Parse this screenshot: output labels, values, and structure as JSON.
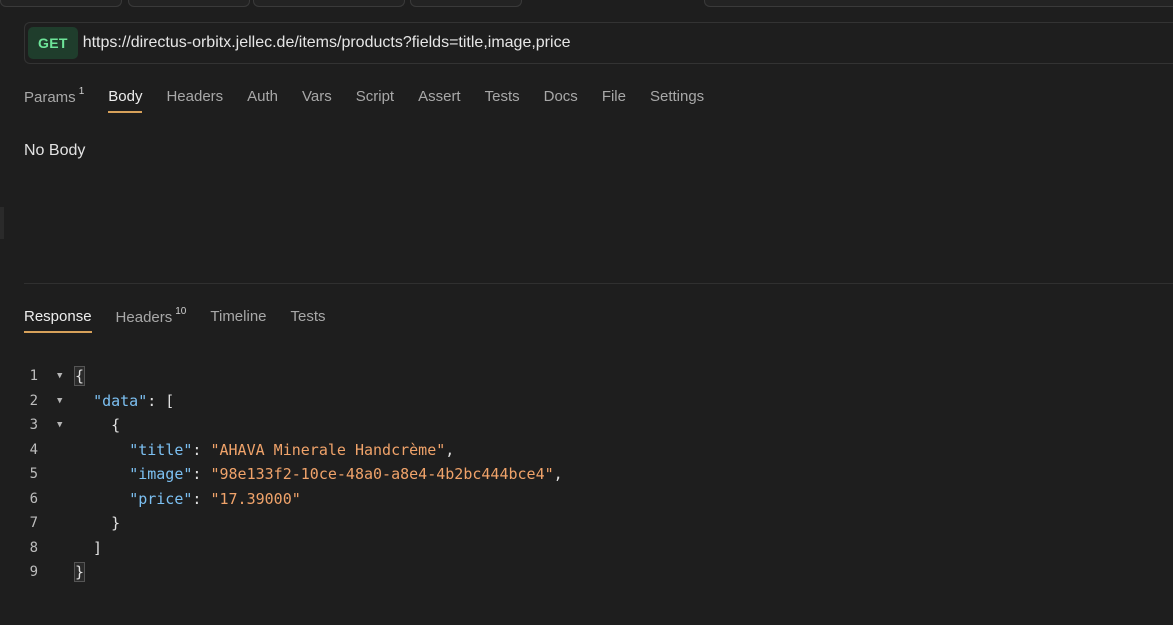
{
  "request": {
    "method": "GET",
    "url": "https://directus-orbitx.jellec.de/items/products?fields=title,image,price"
  },
  "request_tabs": [
    {
      "label": "Params",
      "count": "1"
    },
    {
      "label": "Body",
      "active": true
    },
    {
      "label": "Headers"
    },
    {
      "label": "Auth"
    },
    {
      "label": "Vars"
    },
    {
      "label": "Script"
    },
    {
      "label": "Assert"
    },
    {
      "label": "Tests"
    },
    {
      "label": "Docs"
    },
    {
      "label": "File"
    },
    {
      "label": "Settings"
    }
  ],
  "body_panel": {
    "message": "No Body"
  },
  "response_tabs": [
    {
      "label": "Response",
      "active": true
    },
    {
      "label": "Headers",
      "count": "10"
    },
    {
      "label": "Timeline"
    },
    {
      "label": "Tests"
    }
  ],
  "response_code": [
    {
      "num": "1",
      "fold": true,
      "tokens": [
        {
          "t": "{",
          "c": "punct"
        }
      ]
    },
    {
      "num": "2",
      "fold": true,
      "tokens": [
        {
          "t": "  ",
          "c": "punct"
        },
        {
          "t": "\"data\"",
          "c": "key"
        },
        {
          "t": ": [",
          "c": "punct"
        }
      ]
    },
    {
      "num": "3",
      "fold": true,
      "tokens": [
        {
          "t": "    {",
          "c": "punct"
        }
      ]
    },
    {
      "num": "4",
      "fold": false,
      "tokens": [
        {
          "t": "      ",
          "c": "punct"
        },
        {
          "t": "\"title\"",
          "c": "key"
        },
        {
          "t": ": ",
          "c": "punct"
        },
        {
          "t": "\"AHAVA Minerale Handcrème\"",
          "c": "str"
        },
        {
          "t": ",",
          "c": "punct"
        }
      ]
    },
    {
      "num": "5",
      "fold": false,
      "tokens": [
        {
          "t": "      ",
          "c": "punct"
        },
        {
          "t": "\"image\"",
          "c": "key"
        },
        {
          "t": ": ",
          "c": "punct"
        },
        {
          "t": "\"98e133f2-10ce-48a0-a8e4-4b2bc444bce4\"",
          "c": "str"
        },
        {
          "t": ",",
          "c": "punct"
        }
      ]
    },
    {
      "num": "6",
      "fold": false,
      "tokens": [
        {
          "t": "      ",
          "c": "punct"
        },
        {
          "t": "\"price\"",
          "c": "key"
        },
        {
          "t": ": ",
          "c": "punct"
        },
        {
          "t": "\"17.39000\"",
          "c": "str"
        }
      ]
    },
    {
      "num": "7",
      "fold": false,
      "tokens": [
        {
          "t": "    }",
          "c": "punct"
        }
      ]
    },
    {
      "num": "8",
      "fold": false,
      "tokens": [
        {
          "t": "  ]",
          "c": "punct"
        }
      ]
    },
    {
      "num": "9",
      "fold": false,
      "tokens": [
        {
          "t": "}",
          "c": "punct"
        }
      ]
    }
  ],
  "colors": {
    "accent_underline": "#d7a15a",
    "method_get": "#6ee59a",
    "json_key": "#7cc0f2",
    "json_string": "#f0a36a"
  },
  "icons": {
    "fold": "caret-down-icon"
  }
}
